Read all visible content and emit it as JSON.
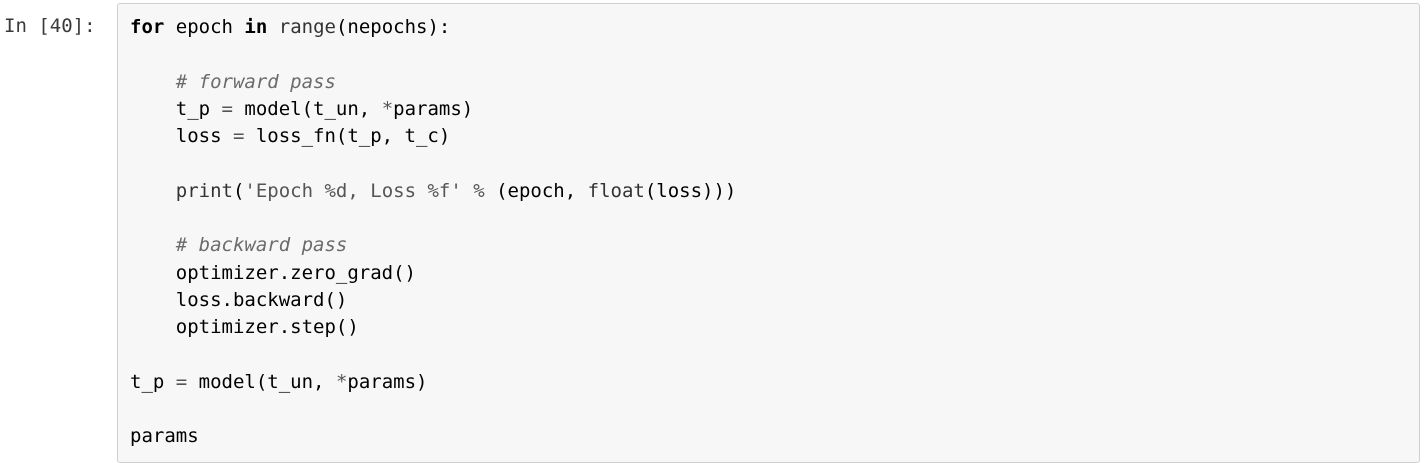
{
  "cell": {
    "prompt": "In [40]:",
    "lines": [
      [
        {
          "t": "for",
          "c": "kw"
        },
        {
          "t": " epoch ",
          "c": ""
        },
        {
          "t": "in",
          "c": "kw"
        },
        {
          "t": " ",
          "c": ""
        },
        {
          "t": "range",
          "c": "bi"
        },
        {
          "t": "(nepochs):",
          "c": ""
        }
      ],
      [],
      [
        {
          "t": "    ",
          "c": ""
        },
        {
          "t": "# forward pass",
          "c": "cm"
        }
      ],
      [
        {
          "t": "    t_p ",
          "c": ""
        },
        {
          "t": "=",
          "c": "op"
        },
        {
          "t": " model(t_un, ",
          "c": ""
        },
        {
          "t": "*",
          "c": "op"
        },
        {
          "t": "params)",
          "c": ""
        }
      ],
      [
        {
          "t": "    loss ",
          "c": ""
        },
        {
          "t": "=",
          "c": "op"
        },
        {
          "t": " loss_fn(t_p, t_c)",
          "c": ""
        }
      ],
      [],
      [
        {
          "t": "    ",
          "c": ""
        },
        {
          "t": "print",
          "c": "bi"
        },
        {
          "t": "(",
          "c": ""
        },
        {
          "t": "'Epoch %d, Loss %f'",
          "c": "str"
        },
        {
          "t": " ",
          "c": ""
        },
        {
          "t": "%",
          "c": "op"
        },
        {
          "t": " (epoch, ",
          "c": ""
        },
        {
          "t": "float",
          "c": "bi"
        },
        {
          "t": "(loss)))",
          "c": ""
        }
      ],
      [],
      [
        {
          "t": "    ",
          "c": ""
        },
        {
          "t": "# backward pass",
          "c": "cm"
        }
      ],
      [
        {
          "t": "    optimizer.zero_grad()",
          "c": ""
        }
      ],
      [
        {
          "t": "    loss.backward()",
          "c": ""
        }
      ],
      [
        {
          "t": "    optimizer.step()",
          "c": ""
        }
      ],
      [],
      [
        {
          "t": "t_p ",
          "c": ""
        },
        {
          "t": "=",
          "c": "op"
        },
        {
          "t": " model(t_un, ",
          "c": ""
        },
        {
          "t": "*",
          "c": "op"
        },
        {
          "t": "params)",
          "c": ""
        }
      ],
      [],
      [
        {
          "t": "params",
          "c": ""
        }
      ]
    ]
  },
  "colors": {
    "editor_background": "#f7f7f7",
    "editor_border": "#cfcfcf",
    "prompt": "#3a3a3a",
    "text": "#000000"
  }
}
